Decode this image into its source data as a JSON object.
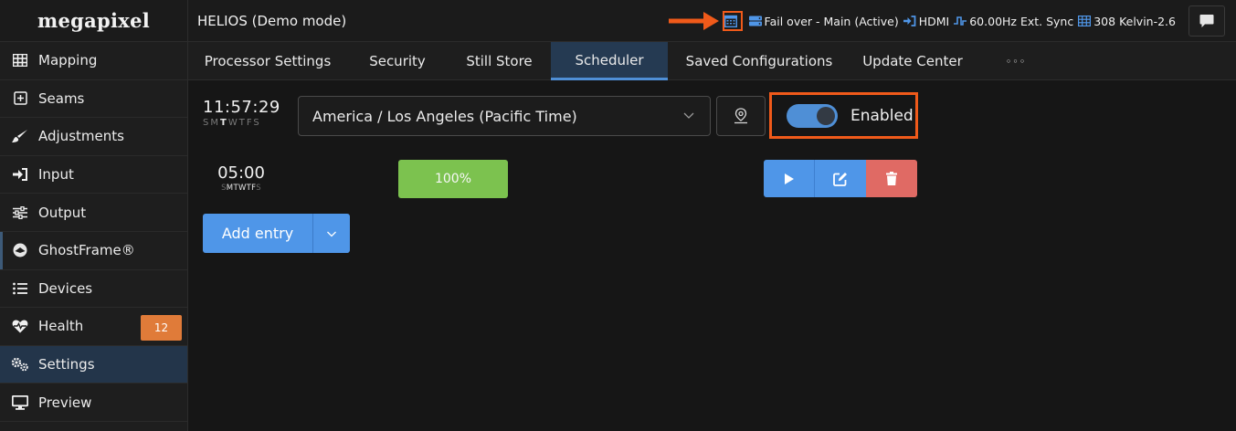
{
  "brand": {
    "logo": "megapixel"
  },
  "header": {
    "title": "HELIOS (Demo mode)",
    "status": {
      "failover": "Fail over - Main (Active)",
      "input": "HDMI",
      "sync": "60.00Hz Ext. Sync",
      "kelvin": "308 Kelvin-2.6"
    },
    "highlight_color": "#f05a1a"
  },
  "sidebar": {
    "items": [
      {
        "label": "Mapping",
        "icon": "grid-icon"
      },
      {
        "label": "Seams",
        "icon": "plus-square-icon"
      },
      {
        "label": "Adjustments",
        "icon": "brush-icon"
      },
      {
        "label": "Input",
        "icon": "sign-in-icon"
      },
      {
        "label": "Output",
        "icon": "sliders-icon"
      },
      {
        "label": "GhostFrame®",
        "icon": "ghostframe-icon"
      },
      {
        "label": "Devices",
        "icon": "list-icon"
      },
      {
        "label": "Health",
        "icon": "heartbeat-icon",
        "badge": "12"
      },
      {
        "label": "Settings",
        "icon": "gears-icon",
        "active": true
      },
      {
        "label": "Preview",
        "icon": "monitor-icon"
      }
    ]
  },
  "tabs": [
    {
      "label": "Processor Settings"
    },
    {
      "label": "Security"
    },
    {
      "label": "Still Store"
    },
    {
      "label": "Scheduler",
      "active": true
    },
    {
      "label": "Saved Configurations"
    },
    {
      "label": "Update Center"
    },
    {
      "label": "◦◦◦"
    }
  ],
  "scheduler": {
    "clock": "11:57:29",
    "days": "SMTWTFS",
    "timezone": "America / Los Angeles (Pacific Time)",
    "toggle_label": "Enabled",
    "toggle_on": true,
    "entries": [
      {
        "time": "05:00",
        "days": "SMTWTFS",
        "level": "100%"
      }
    ],
    "add_label": "Add entry"
  }
}
